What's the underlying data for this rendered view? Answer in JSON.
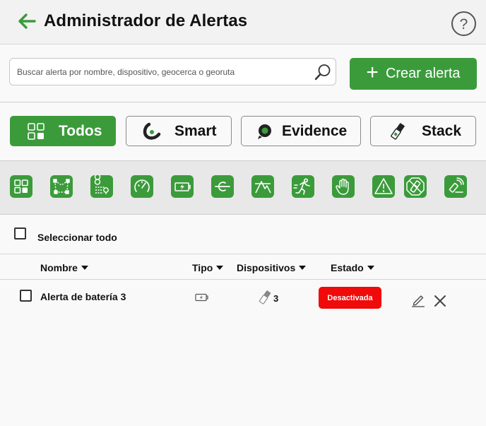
{
  "header": {
    "title": "Administrador de Alertas"
  },
  "search": {
    "placeholder": "Buscar alerta por nombre, dispositivo, geocerca o georuta"
  },
  "create_button": {
    "label": "Crear alerta"
  },
  "type_filters": [
    {
      "label": "Todos",
      "icon": "grid-icon",
      "active": true
    },
    {
      "label": "Smart",
      "icon": "smart-logo-icon",
      "active": false
    },
    {
      "label": "Evidence",
      "icon": "evidence-logo-icon",
      "active": false
    },
    {
      "label": "Stack",
      "icon": "stack-device-icon",
      "active": false
    }
  ],
  "category_icons": [
    "grid-icon",
    "geofence-icon",
    "georoute-icon",
    "speedometer-icon",
    "battery-icon",
    "ignition-icon",
    "altitude-icon",
    "motion-icon",
    "stop-hand-icon",
    "warning-icon",
    "tamper-icon",
    "jamming-icon"
  ],
  "select_all": {
    "label": "Seleccionar todo"
  },
  "columns": {
    "name": "Nombre",
    "type": "Tipo",
    "devices": "Dispositivos",
    "status": "Estado"
  },
  "alerts": [
    {
      "name": "Alerta de batería 3",
      "type_icon": "battery-icon",
      "devices": "3",
      "status": "Desactivada",
      "status_color": "#f00a0a"
    }
  ],
  "colors": {
    "accent": "#3b9b3b",
    "danger": "#f00a0a"
  }
}
